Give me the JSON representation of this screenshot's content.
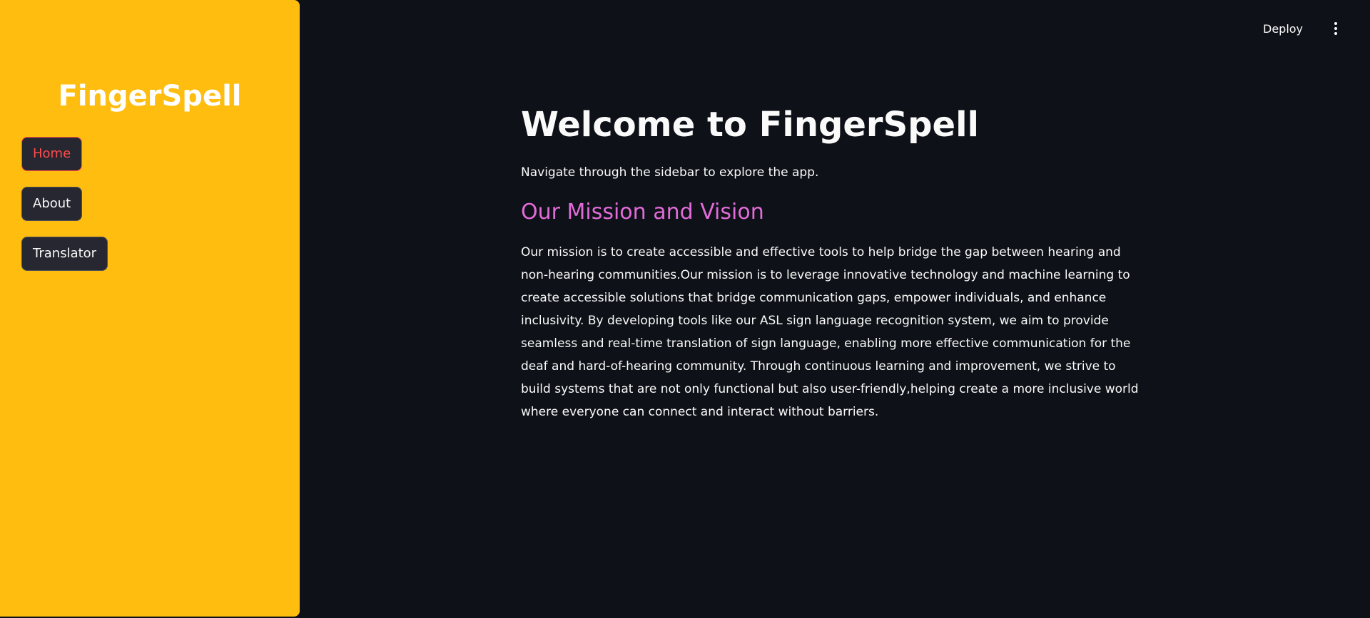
{
  "sidebar": {
    "title": "FingerSpell",
    "items": [
      {
        "label": "Home",
        "active": true
      },
      {
        "label": "About",
        "active": false
      },
      {
        "label": "Translator",
        "active": false
      }
    ]
  },
  "header": {
    "deploy_label": "Deploy",
    "menu_icon": "kebab-menu-icon"
  },
  "main": {
    "title": "Welcome to FingerSpell",
    "subtitle": "Navigate through the sidebar to explore the app.",
    "section_heading": "Our Mission and Vision",
    "section_text": "Our mission is to create accessible and effective tools to help bridge the gap between hearing and non-hearing communities.Our mission is to leverage innovative technology and machine learning to create accessible solutions that bridge communication gaps, empower individuals, and enhance inclusivity. By developing tools like our ASL sign language recognition system, we aim to provide seamless and real-time translation of sign language, enabling more effective communication for the deaf and hard-of-hearing community. Through continuous learning and improvement, we strive to build systems that are not only functional but also user-friendly,helping create a more inclusive world where everyone can connect and interact without barriers."
  },
  "colors": {
    "sidebar_bg": "#ffbd10",
    "page_bg": "#0e1117",
    "accent": "#ff4b4b",
    "heading_accent": "#e16bd9",
    "button_bg": "#262730"
  }
}
